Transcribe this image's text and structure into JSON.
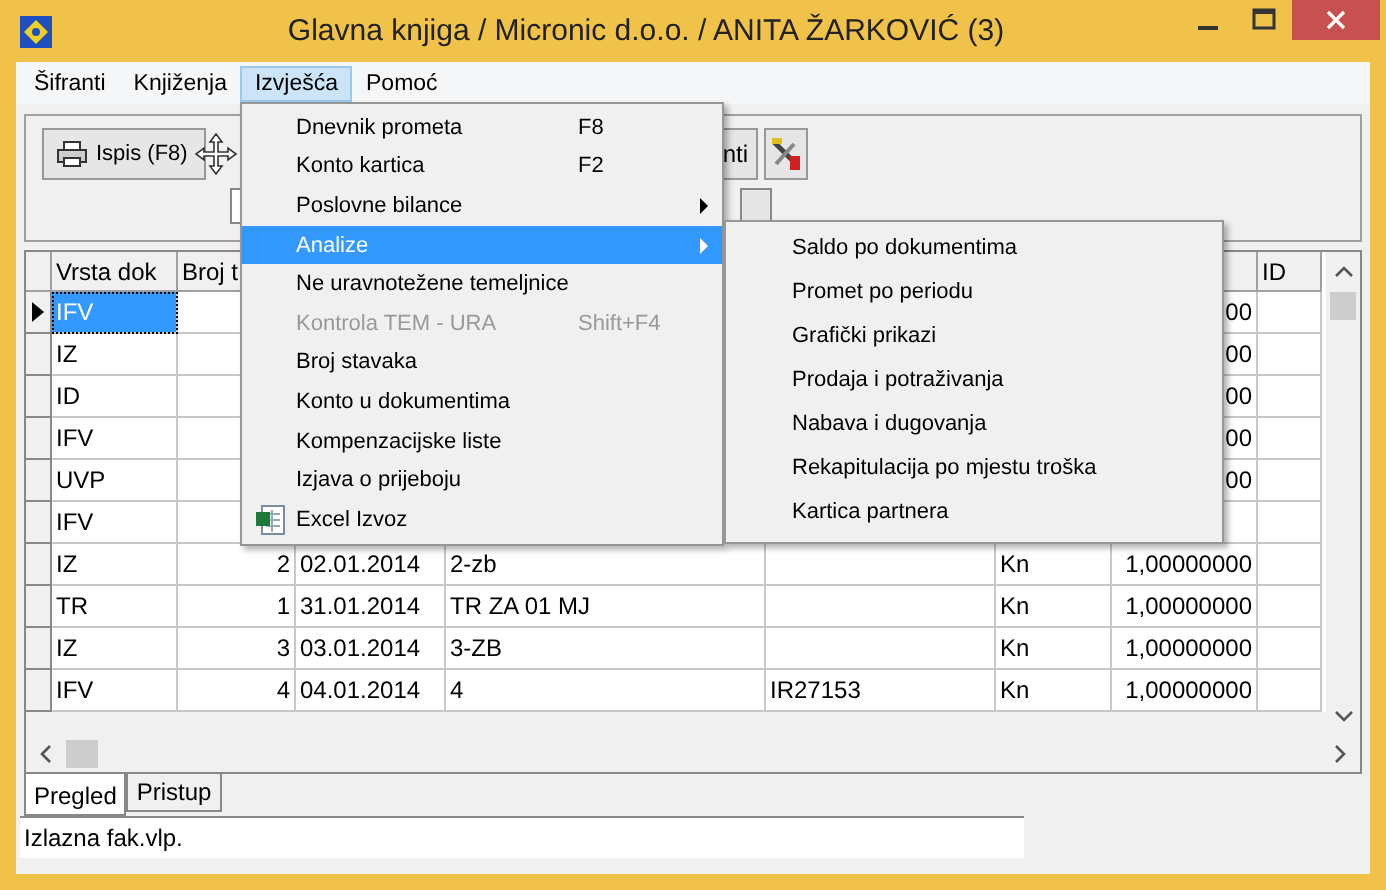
{
  "window": {
    "title": "Glavna knjiga / Micronic d.o.o.  / ANITA ŽARKOVIĆ (3)"
  },
  "menu_bar": [
    {
      "label": "Šifranti",
      "selected": false
    },
    {
      "label": "Knjiženja",
      "selected": false
    },
    {
      "label": "Izvješća",
      "selected": true
    },
    {
      "label": "Pomoć",
      "selected": false
    }
  ],
  "menu": [
    {
      "label": "Dnevnik prometa",
      "shortcut": "F8",
      "disabled": false,
      "submenu": false,
      "selected": false
    },
    {
      "label": "Konto kartica",
      "shortcut": "F2",
      "disabled": false,
      "submenu": false,
      "selected": false
    },
    {
      "label": "Poslovne bilance",
      "disabled": false,
      "submenu": true,
      "selected": false
    },
    {
      "label": "Analize",
      "disabled": false,
      "submenu": true,
      "selected": true
    },
    {
      "label": "Ne uravnotežene temeljnice",
      "disabled": false,
      "submenu": false,
      "selected": false
    },
    {
      "label": "Kontrola TEM - URA",
      "shortcut": "Shift+F4",
      "disabled": true,
      "submenu": false,
      "selected": false
    },
    {
      "label": "Broj stavaka",
      "disabled": false,
      "submenu": false,
      "selected": false
    },
    {
      "label": "Konto u dokumentima",
      "disabled": false,
      "submenu": false,
      "selected": false
    },
    {
      "label": "Kompenzacijske liste",
      "disabled": false,
      "submenu": false,
      "selected": false
    },
    {
      "label": "Izjava o prijeboju",
      "disabled": false,
      "submenu": false,
      "selected": false
    },
    {
      "label": "Excel Izvoz",
      "kind": "export",
      "disabled": false,
      "submenu": false,
      "selected": false
    }
  ],
  "submenu": [
    "Saldo  po dokumentima",
    "Promet po periodu",
    "Grafički prikazi",
    "Prodaja i potraživanja",
    "Nabava i dugovanja",
    "Rekapitulacija po mjestu troška",
    "Kartica partnera"
  ],
  "toolbar": {
    "print_button": "Ispis (F8)",
    "cut_button": "nti"
  },
  "table": {
    "headers": {
      "type": "Vrsta dok",
      "number": "Broj t",
      "id": "ID"
    },
    "rows": [
      {
        "type": "IFV",
        "rate": "00",
        "selected": true
      },
      {
        "type": "IZ",
        "rate": "00",
        "selected": false
      },
      {
        "type": "ID",
        "rate": "00",
        "selected": false
      },
      {
        "type": "IFV",
        "rate": "00",
        "selected": false
      },
      {
        "type": "UVP",
        "rate": "00",
        "selected": false
      },
      {
        "type": "IFV",
        "selected": false
      },
      {
        "type": "IZ",
        "number": "2",
        "date": "02.01.2014",
        "description": "2-zb",
        "currency": "Kn",
        "rate": "1,00000000",
        "selected": false
      },
      {
        "type": "TR",
        "number": "1",
        "date": "31.01.2014",
        "description": "TR ZA 01 MJ",
        "currency": "Kn",
        "rate": "1,00000000",
        "selected": false
      },
      {
        "type": "IZ",
        "number": "3",
        "date": "03.01.2014",
        "description": "3-ZB",
        "currency": "Kn",
        "rate": "1,00000000",
        "selected": false
      },
      {
        "type": "IFV",
        "number": "4",
        "date": "04.01.2014",
        "description": "4",
        "reference": "IR27153",
        "currency": "Kn",
        "rate": "1,00000000",
        "selected": false
      }
    ]
  },
  "tabs": [
    {
      "label": "Pregled",
      "selected": true
    },
    {
      "label": "Pristup",
      "selected": false
    }
  ],
  "status_bar": "Izlazna fak.vlp."
}
